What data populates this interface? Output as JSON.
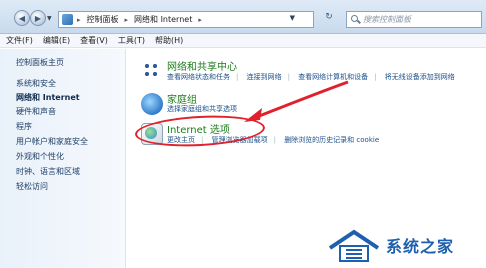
{
  "address_bar": {
    "crumbs": [
      "控制面板",
      "网络和 Internet"
    ],
    "search_placeholder": "搜索控制面板"
  },
  "menu": [
    "文件(F)",
    "编辑(E)",
    "查看(V)",
    "工具(T)",
    "帮助(H)"
  ],
  "sidebar": {
    "items": [
      {
        "label": "控制面板主页",
        "active": false
      },
      {
        "label": "系统和安全",
        "active": false
      },
      {
        "label": "网络和 Internet",
        "active": true
      },
      {
        "label": "硬件和声音",
        "active": false
      },
      {
        "label": "程序",
        "active": false
      },
      {
        "label": "用户帐户和家庭安全",
        "active": false
      },
      {
        "label": "外观和个性化",
        "active": false
      },
      {
        "label": "时钟、语言和区域",
        "active": false
      },
      {
        "label": "轻松访问",
        "active": false
      }
    ]
  },
  "categories": [
    {
      "icon": "network-icon",
      "title": "网络和共享中心",
      "links": [
        "查看网络状态和任务",
        "连接到网络",
        "查看网络计算机和设备",
        "将无线设备添加到网络"
      ]
    },
    {
      "icon": "homegroup-icon",
      "title": "家庭组",
      "links": [
        "选择家庭组和共享选项"
      ]
    },
    {
      "icon": "internet-options-icon",
      "title": "Internet 选项",
      "links": [
        "更改主页",
        "管理浏览器加载项",
        "删除浏览的历史记录和 cookie"
      ]
    }
  ],
  "annotation_color": "#e0212c",
  "watermark": {
    "text": "系统之家",
    "color": "#1e5fb0"
  }
}
